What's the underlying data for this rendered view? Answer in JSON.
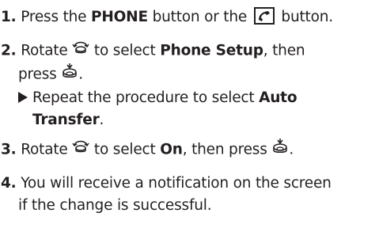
{
  "steps": [
    {
      "number": "1.",
      "lines": [
        {
          "t1": " Press the ",
          "b1": "PHONE",
          "t2": " button or the ",
          "t3": " button."
        }
      ]
    },
    {
      "number": "2.",
      "l1": {
        "t1": " Rotate ",
        "t2": " to select ",
        "b1": "Phone Setup",
        "t3": ", then"
      },
      "l2": {
        "t1": "press ",
        "t2": "."
      },
      "sub": {
        "t1": "Repeat the procedure to select ",
        "b1": "Auto",
        "b2": "Transfer",
        "t2": "."
      }
    },
    {
      "number": "3.",
      "l1": {
        "t1": " Rotate ",
        "t2": " to select ",
        "b1": "On",
        "t3": ", then press ",
        "t4": "."
      }
    },
    {
      "number": "4.",
      "l1": {
        "t1": " You will receive a notification on the screen"
      },
      "l2": {
        "t1": "if the change is successful."
      }
    }
  ],
  "icons": {
    "phone": "phone-handset-icon",
    "dial": "rotate-selector-icon",
    "press": "press-selector-icon",
    "bullet": "triangle-bullet-icon"
  }
}
